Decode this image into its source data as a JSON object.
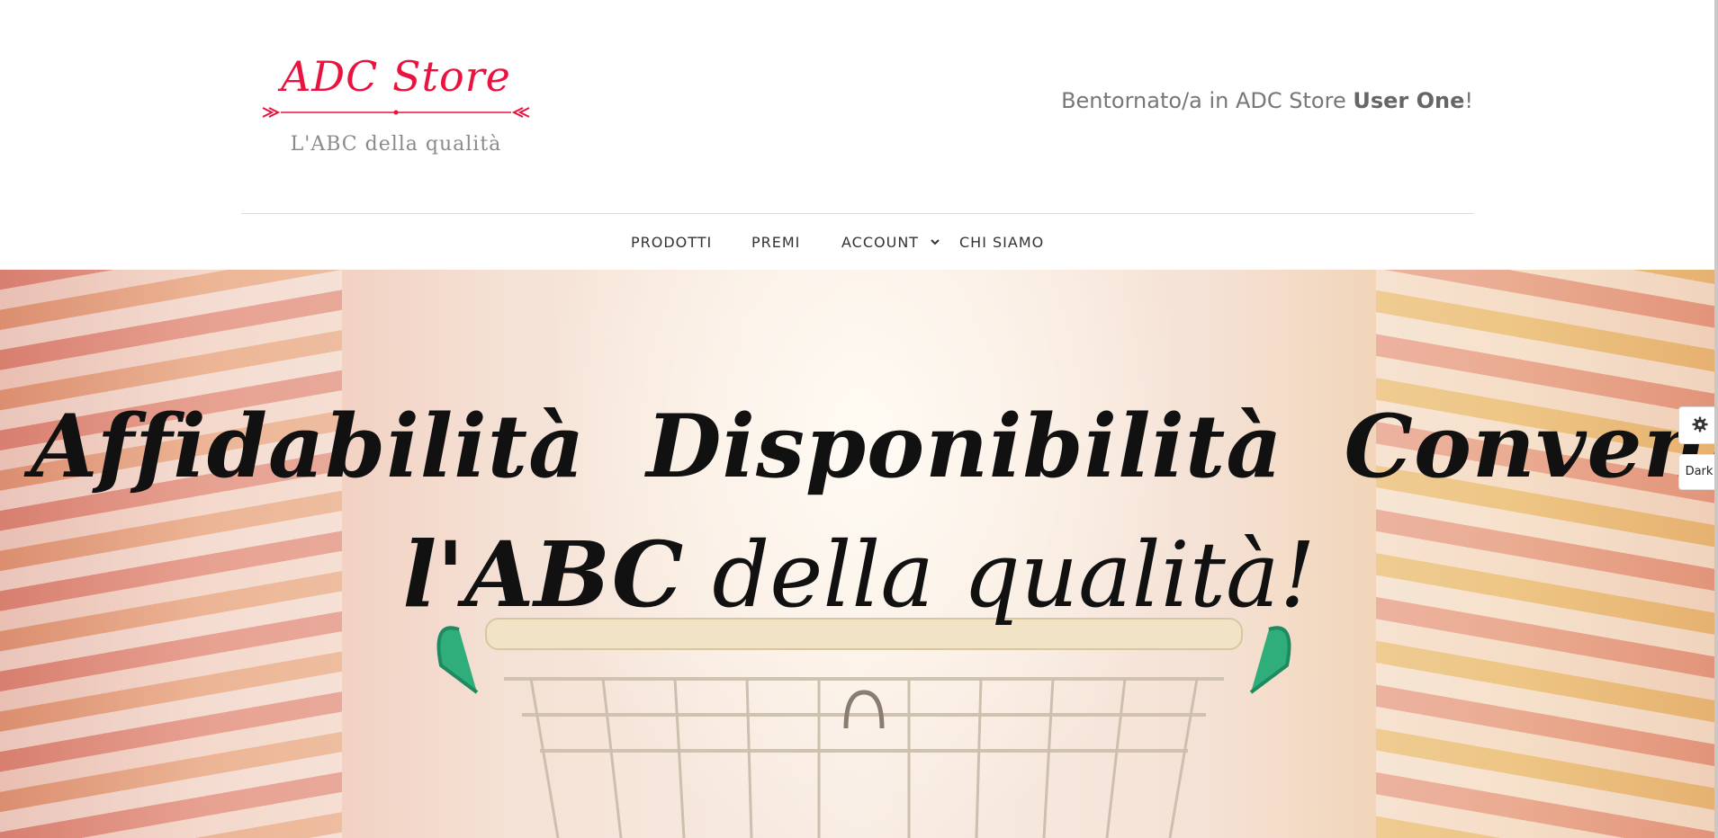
{
  "logo": {
    "title": "ADC Store",
    "tagline": "L'ABC della qualità"
  },
  "welcome": {
    "prefix": "Bentornato/a in ADC Store ",
    "user": "User One",
    "suffix": "!"
  },
  "nav": {
    "items": [
      {
        "label": "PRODOTTI"
      },
      {
        "label": "PREMI"
      },
      {
        "label": "ACCOUNT"
      },
      {
        "label": "CHI SIAMO"
      }
    ]
  },
  "hero": {
    "words": [
      "Affidabilità",
      "Disponibilità",
      "Convenienza"
    ],
    "tagline_bold": "l'ABC",
    "tagline_rest": " della qualità!"
  },
  "side_controls": {
    "theme_toggle_label": "Dark"
  },
  "colors": {
    "brand": "#e8133f",
    "text_muted": "#777777"
  }
}
